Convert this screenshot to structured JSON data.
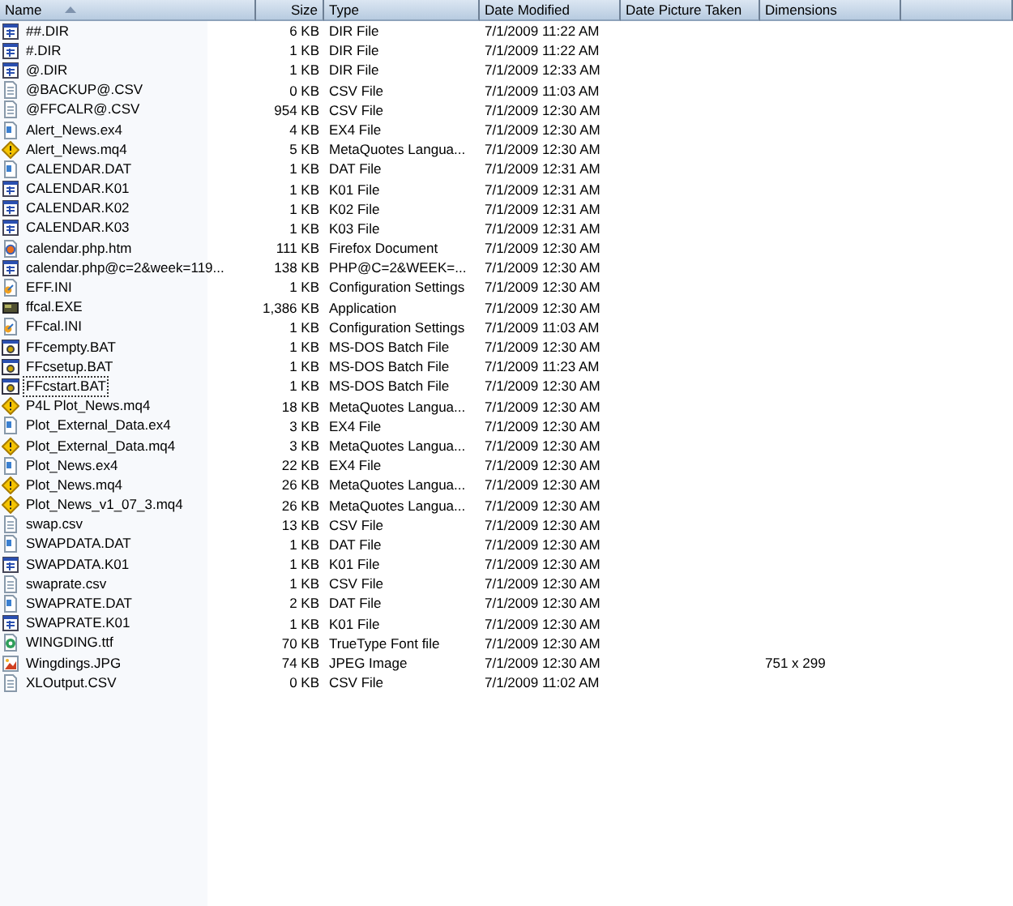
{
  "columns": [
    {
      "label": "Name",
      "sorted": true
    },
    {
      "label": "Size",
      "sorted": false
    },
    {
      "label": "Type",
      "sorted": false
    },
    {
      "label": "Date Modified",
      "sorted": false
    },
    {
      "label": "Date Picture Taken",
      "sorted": false
    },
    {
      "label": "Dimensions",
      "sorted": false
    }
  ],
  "rows": [
    {
      "kind": "grid",
      "name": "##.DIR",
      "size": "6 KB",
      "type": "DIR File",
      "modified": "7/1/2009 11:22 AM",
      "focused": false
    },
    {
      "kind": "grid",
      "name": "#.DIR",
      "size": "1 KB",
      "type": "DIR File",
      "modified": "7/1/2009 11:22 AM",
      "focused": false
    },
    {
      "kind": "grid",
      "name": "@.DIR",
      "size": "1 KB",
      "type": "DIR File",
      "modified": "7/1/2009 12:33 AM",
      "focused": false
    },
    {
      "kind": "text",
      "name": "@BACKUP@.CSV",
      "size": "0 KB",
      "type": "CSV File",
      "modified": "7/1/2009 11:03 AM",
      "focused": false
    },
    {
      "kind": "text",
      "name": "@FFCALR@.CSV",
      "size": "954 KB",
      "type": "CSV File",
      "modified": "7/1/2009 12:30 AM",
      "focused": false
    },
    {
      "kind": "blue",
      "name": "Alert_News.ex4",
      "size": "4 KB",
      "type": "EX4 File",
      "modified": "7/1/2009 12:30 AM",
      "focused": false
    },
    {
      "kind": "diamond",
      "name": "Alert_News.mq4",
      "size": "5 KB",
      "type": "MetaQuotes Langua...",
      "modified": "7/1/2009 12:30 AM",
      "focused": false
    },
    {
      "kind": "blue",
      "name": "CALENDAR.DAT",
      "size": "1 KB",
      "type": "DAT File",
      "modified": "7/1/2009 12:31 AM",
      "focused": false
    },
    {
      "kind": "grid",
      "name": "CALENDAR.K01",
      "size": "1 KB",
      "type": "K01 File",
      "modified": "7/1/2009 12:31 AM",
      "focused": false
    },
    {
      "kind": "grid",
      "name": "CALENDAR.K02",
      "size": "1 KB",
      "type": "K02 File",
      "modified": "7/1/2009 12:31 AM",
      "focused": false
    },
    {
      "kind": "grid",
      "name": "CALENDAR.K03",
      "size": "1 KB",
      "type": "K03 File",
      "modified": "7/1/2009 12:31 AM",
      "focused": false
    },
    {
      "kind": "web",
      "name": "calendar.php.htm",
      "size": "111 KB",
      "type": "Firefox Document",
      "modified": "7/1/2009 12:30 AM",
      "focused": false
    },
    {
      "kind": "grid",
      "name": "calendar.php@c=2&week=119...",
      "size": "138 KB",
      "type": "PHP@C=2&WEEK=...",
      "modified": "7/1/2009 12:30 AM",
      "focused": false
    },
    {
      "kind": "config",
      "name": "EFF.INI",
      "size": "1 KB",
      "type": "Configuration Settings",
      "modified": "7/1/2009 12:30 AM",
      "focused": false
    },
    {
      "kind": "app",
      "name": "ffcal.EXE",
      "size": "1,386 KB",
      "type": "Application",
      "modified": "7/1/2009 12:30 AM",
      "focused": false
    },
    {
      "kind": "config",
      "name": "FFcal.INI",
      "size": "1 KB",
      "type": "Configuration Settings",
      "modified": "7/1/2009 11:03 AM",
      "focused": false
    },
    {
      "kind": "batch",
      "name": "FFcempty.BAT",
      "size": "1 KB",
      "type": "MS-DOS Batch File",
      "modified": "7/1/2009 12:30 AM",
      "focused": false
    },
    {
      "kind": "batch",
      "name": "FFcsetup.BAT",
      "size": "1 KB",
      "type": "MS-DOS Batch File",
      "modified": "7/1/2009 11:23 AM",
      "focused": false
    },
    {
      "kind": "batch",
      "name": "FFcstart.BAT",
      "size": "1 KB",
      "type": "MS-DOS Batch File",
      "modified": "7/1/2009 12:30 AM",
      "focused": true
    },
    {
      "kind": "diamond",
      "name": "P4L Plot_News.mq4",
      "size": "18 KB",
      "type": "MetaQuotes Langua...",
      "modified": "7/1/2009 12:30 AM",
      "focused": false
    },
    {
      "kind": "blue",
      "name": "Plot_External_Data.ex4",
      "size": "3 KB",
      "type": "EX4 File",
      "modified": "7/1/2009 12:30 AM",
      "focused": false
    },
    {
      "kind": "diamond",
      "name": "Plot_External_Data.mq4",
      "size": "3 KB",
      "type": "MetaQuotes Langua...",
      "modified": "7/1/2009 12:30 AM",
      "focused": false
    },
    {
      "kind": "blue",
      "name": "Plot_News.ex4",
      "size": "22 KB",
      "type": "EX4 File",
      "modified": "7/1/2009 12:30 AM",
      "focused": false
    },
    {
      "kind": "diamond",
      "name": "Plot_News.mq4",
      "size": "26 KB",
      "type": "MetaQuotes Langua...",
      "modified": "7/1/2009 12:30 AM",
      "focused": false
    },
    {
      "kind": "diamond",
      "name": "Plot_News_v1_07_3.mq4",
      "size": "26 KB",
      "type": "MetaQuotes Langua...",
      "modified": "7/1/2009 12:30 AM",
      "focused": false
    },
    {
      "kind": "text",
      "name": "swap.csv",
      "size": "13 KB",
      "type": "CSV File",
      "modified": "7/1/2009 12:30 AM",
      "focused": false
    },
    {
      "kind": "blue",
      "name": "SWAPDATA.DAT",
      "size": "1 KB",
      "type": "DAT File",
      "modified": "7/1/2009 12:30 AM",
      "focused": false
    },
    {
      "kind": "grid",
      "name": "SWAPDATA.K01",
      "size": "1 KB",
      "type": "K01 File",
      "modified": "7/1/2009 12:30 AM",
      "focused": false
    },
    {
      "kind": "text",
      "name": "swaprate.csv",
      "size": "1 KB",
      "type": "CSV File",
      "modified": "7/1/2009 12:30 AM",
      "focused": false
    },
    {
      "kind": "blue",
      "name": "SWAPRATE.DAT",
      "size": "2 KB",
      "type": "DAT File",
      "modified": "7/1/2009 12:30 AM",
      "focused": false
    },
    {
      "kind": "grid",
      "name": "SWAPRATE.K01",
      "size": "1 KB",
      "type": "K01 File",
      "modified": "7/1/2009 12:30 AM",
      "focused": false
    },
    {
      "kind": "font",
      "name": "WINGDING.ttf",
      "size": "70 KB",
      "type": "TrueType Font file",
      "modified": "7/1/2009 12:30 AM",
      "focused": false
    },
    {
      "kind": "image",
      "name": "Wingdings.JPG",
      "size": "74 KB",
      "type": "JPEG Image",
      "modified": "7/1/2009 12:30 AM",
      "dimensions": "751 x 299",
      "focused": false
    },
    {
      "kind": "text",
      "name": "XLOutput.CSV",
      "size": "0 KB",
      "type": "CSV File",
      "modified": "7/1/2009 11:02 AM",
      "focused": false
    }
  ]
}
